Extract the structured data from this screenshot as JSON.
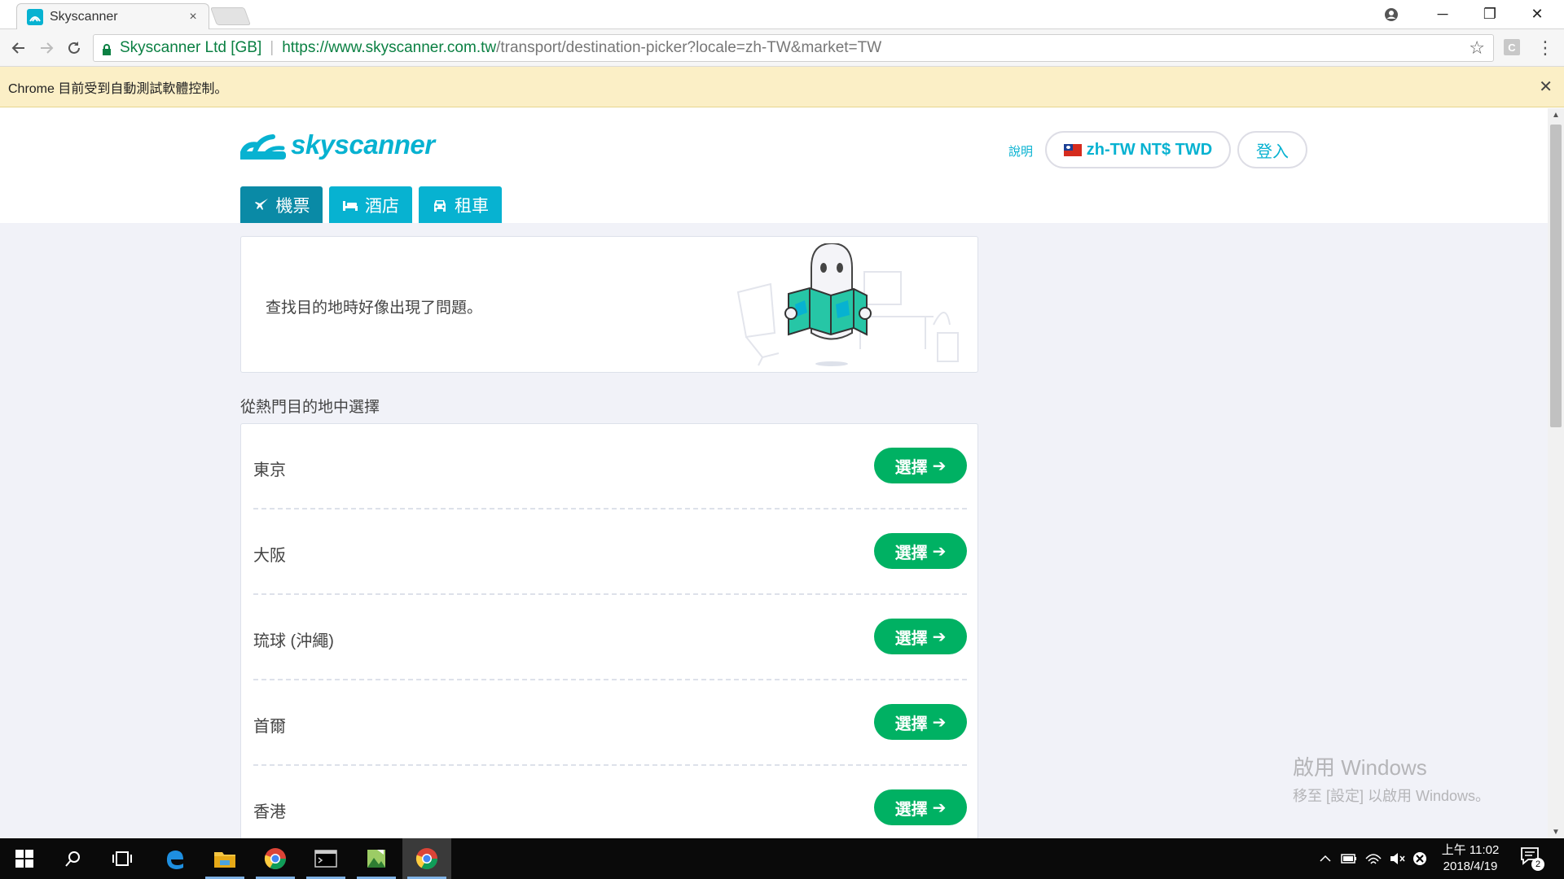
{
  "browser": {
    "tab": {
      "title": "Skyscanner",
      "close": "×"
    },
    "window_controls": {
      "minimize": "─",
      "restore": "❐",
      "close": "✕"
    },
    "omnibox": {
      "owner": "Skyscanner Ltd [GB]",
      "url_scheme_host": "https://www.skyscanner.com.tw",
      "url_path": "/transport/destination-picker?locale=zh-TW&market=TW"
    },
    "ext_label": "C",
    "infobar": {
      "text": "Chrome 目前受到自動測試軟體控制。",
      "close": "✕"
    }
  },
  "page": {
    "brand": "skyscanner",
    "header": {
      "help": "說明",
      "locale": "zh-TW NT$ TWD",
      "login": "登入"
    },
    "nav_tabs": [
      {
        "label": "機票",
        "icon": "plane-icon"
      },
      {
        "label": "酒店",
        "icon": "bed-icon"
      },
      {
        "label": "租車",
        "icon": "car-icon"
      }
    ],
    "error_message": "查找目的地時好像出現了問題。",
    "section_title": "從熱門目的地中選擇",
    "destinations": [
      {
        "name": "東京",
        "button": "選擇"
      },
      {
        "name": "大阪",
        "button": "選擇"
      },
      {
        "name": "琉球 (沖繩)",
        "button": "選擇"
      },
      {
        "name": "首爾",
        "button": "選擇"
      },
      {
        "name": "香港",
        "button": "選擇"
      }
    ],
    "watermark": {
      "line1": "啟用 Windows",
      "line2": "移至 [設定] 以啟用 Windows。"
    }
  },
  "taskbar": {
    "clock_period_time": "上午 11:02",
    "clock_date": "2018/4/19",
    "notification_count": "2"
  },
  "colors": {
    "brand": "#07b2d1",
    "brand_active": "#0a8aa6",
    "select_green": "#00b163",
    "infobar": "#fbefc6",
    "page_bg": "#f1f2f8"
  }
}
